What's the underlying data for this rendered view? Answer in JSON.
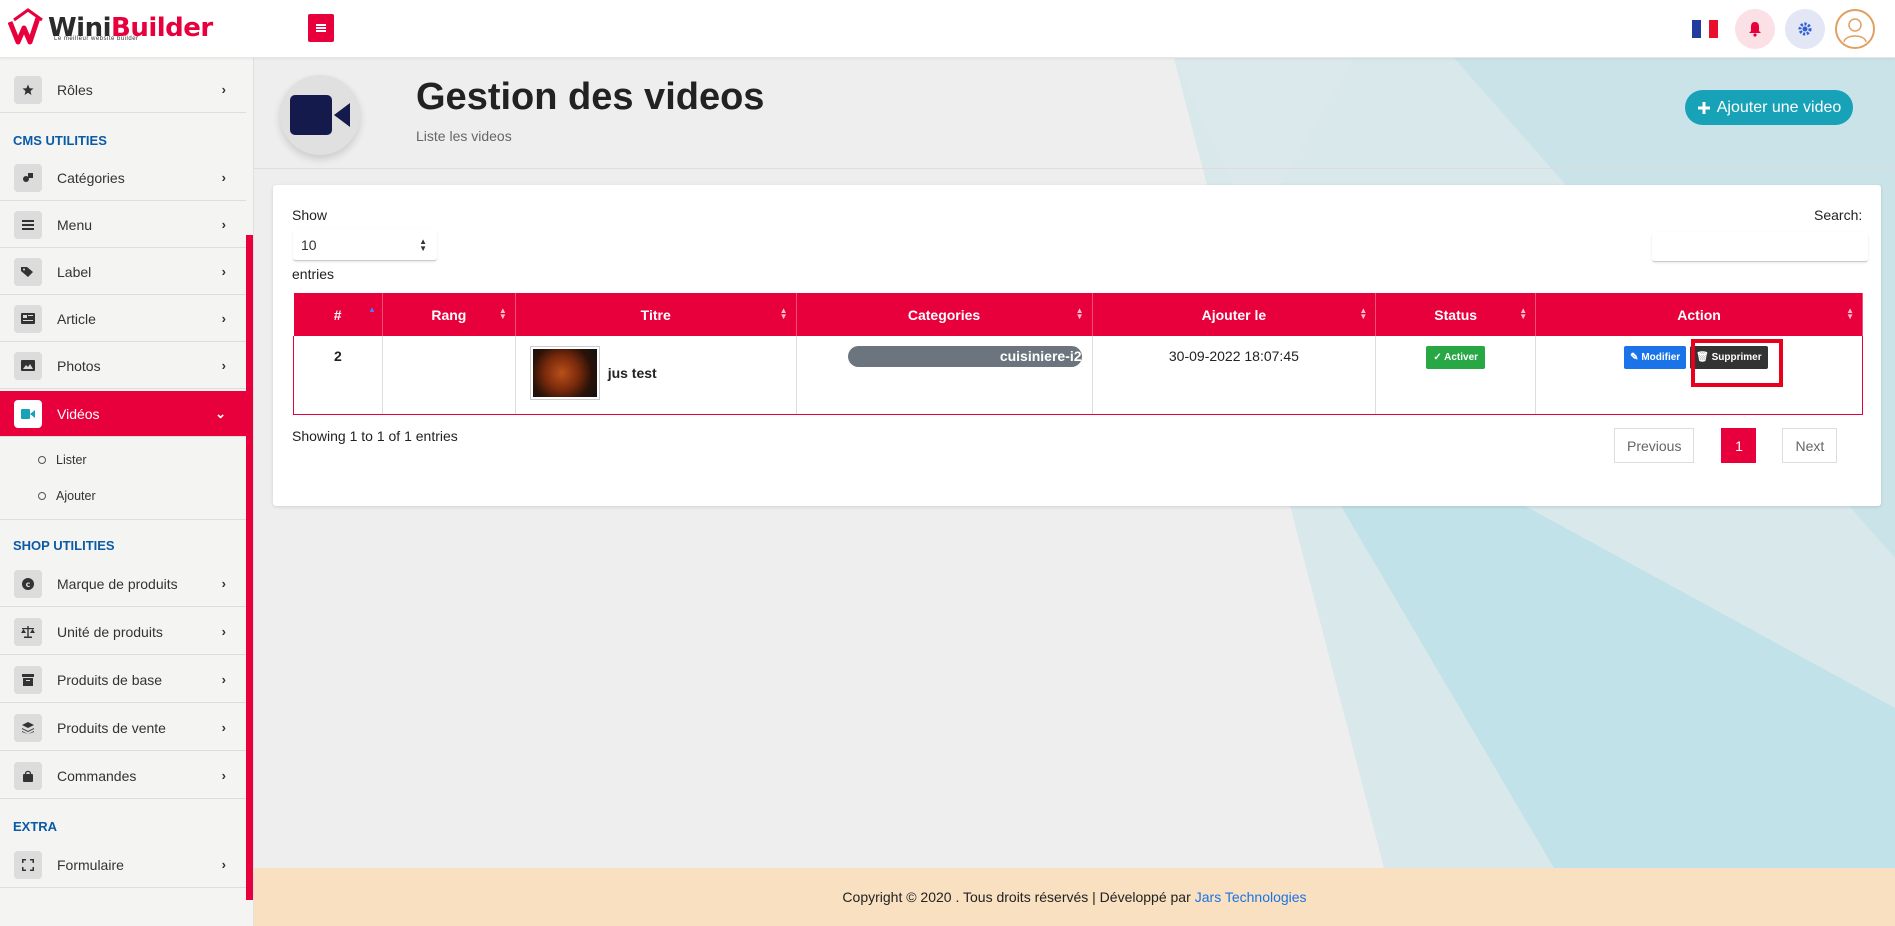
{
  "topbar": {
    "logo_text_1": "Wini",
    "logo_text_2": "Builder",
    "logo_tagline": "Le meilleur website builder"
  },
  "sidebar": {
    "items_top": [
      {
        "label": "Rôles",
        "icon": "star-icon"
      }
    ],
    "sections": [
      {
        "title": "CMS UTILITIES"
      },
      {
        "title": "SHOP UTILITIES"
      },
      {
        "title": "EXTRA"
      }
    ],
    "cms_items": [
      {
        "label": "Catégories",
        "icon": "shapes-icon"
      },
      {
        "label": "Menu",
        "icon": "list-icon"
      },
      {
        "label": "Label",
        "icon": "tags-icon"
      },
      {
        "label": "Article",
        "icon": "newspaper-icon"
      },
      {
        "label": "Photos",
        "icon": "image-icon"
      },
      {
        "label": "Vidéos",
        "icon": "video-icon"
      }
    ],
    "video_submenu": [
      {
        "label": "Lister"
      },
      {
        "label": "Ajouter"
      }
    ],
    "shop_items": [
      {
        "label": "Marque de produits",
        "icon": "copyright-icon"
      },
      {
        "label": "Unité de produits",
        "icon": "balance-icon"
      },
      {
        "label": "Produits de base",
        "icon": "archive-icon"
      },
      {
        "label": "Produits de vente",
        "icon": "layers-icon"
      },
      {
        "label": "Commandes",
        "icon": "bag-icon"
      }
    ],
    "extra_items": [
      {
        "label": "Formulaire",
        "icon": "expand-icon"
      }
    ]
  },
  "header": {
    "title": "Gestion des videos",
    "subtitle": "Liste les videos",
    "add_button": "Ajouter une video"
  },
  "table_controls": {
    "show_label": "Show",
    "page_length": "10",
    "entries_label": "entries",
    "search_label": "Search:"
  },
  "table": {
    "columns": [
      "#",
      "Rang",
      "Titre",
      "Categories",
      "Ajouter le",
      "Status",
      "Action"
    ],
    "rows": [
      {
        "id": "2",
        "rang": "",
        "titre": "jus test",
        "categorie": "cuisiniere-i2",
        "date": "30-09-2022 18:07:45",
        "status": "Activer",
        "edit": "Modifier",
        "delete": "Supprimer"
      }
    ]
  },
  "pagination": {
    "info": "Showing 1 to 1 of 1 entries",
    "previous": "Previous",
    "current": "1",
    "next": "Next"
  },
  "footer": {
    "text": "Copyright © 2020 . Tous droits réservés | Développé par",
    "link": "Jars Technologies"
  },
  "colors": {
    "accent": "#e8003d",
    "teal": "#17a2b8",
    "success": "#28a745",
    "primary": "#1a73e8",
    "section_title": "#0b5aa6"
  }
}
